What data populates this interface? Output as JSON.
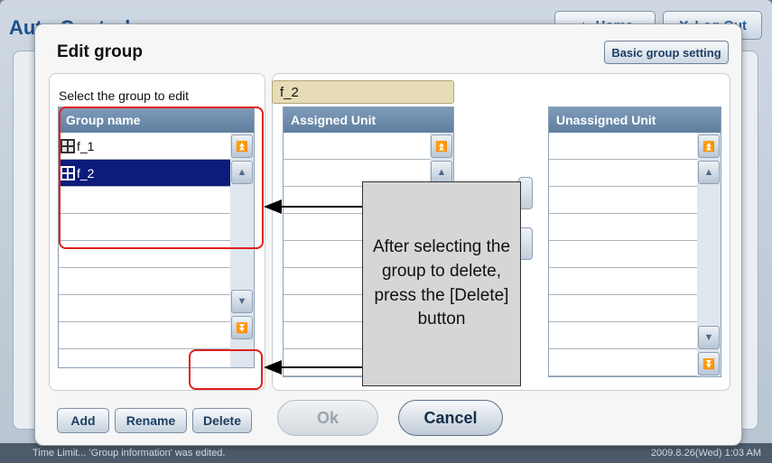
{
  "app": {
    "title": "Auto Control",
    "home_label": "Home",
    "logout_label": "Log Out"
  },
  "status_bar": {
    "message": "Time Limit... 'Group information' was edited.",
    "datetime": "2009.8.26(Wed) 1:03 AM"
  },
  "dialog": {
    "title": "Edit group",
    "basic_group_setting": "Basic group setting",
    "select_label": "Select the group to edit",
    "group_list": {
      "header": "Group name",
      "rows": [
        "f_1",
        "f_2",
        "",
        "",
        "",
        "",
        "",
        ""
      ],
      "selected": "f_2"
    },
    "name_field_value": "f_2",
    "assigned_header": "Assigned Unit",
    "unassigned_header": "Unassigned Unit",
    "buttons": {
      "add": "Add",
      "rename": "Rename",
      "delete": "Delete",
      "ok": "Ok",
      "cancel": "Cancel"
    }
  },
  "annotation": {
    "callout_text": "After selecting the group to delete, press the [Delete] button",
    "highlight_color": "#e0201c"
  },
  "colors": {
    "selected_row": "#0b1c7a",
    "list_header": "#6a88a8",
    "name_field": "#e6dcb5"
  }
}
